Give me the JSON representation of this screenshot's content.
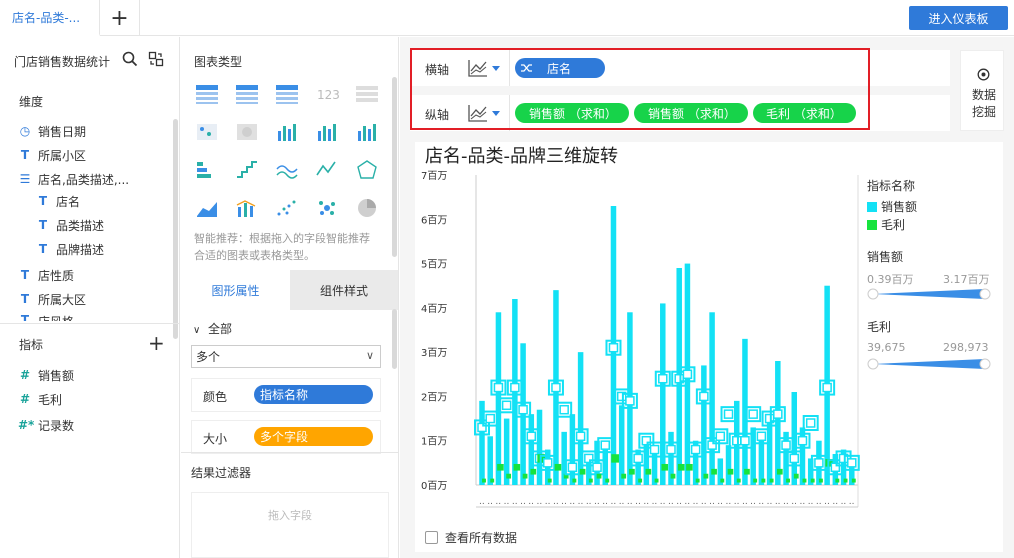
{
  "topbar": {
    "tab_label": "店名-品类-...",
    "add_label": "+",
    "enter_button": "进入仪表板"
  },
  "left": {
    "title": "门店销售数据统计",
    "dimension_label": "维度",
    "dimensions": [
      {
        "icon": "clock-icon",
        "label": "销售日期"
      },
      {
        "icon": "text-field-icon",
        "label": "所属小区"
      },
      {
        "icon": "tree-icon",
        "label": "店名,品类描述,..."
      },
      {
        "icon": "text-field-icon",
        "label": "店名",
        "sub": true
      },
      {
        "icon": "text-field-icon",
        "label": "品类描述",
        "sub": true
      },
      {
        "icon": "text-field-icon",
        "label": "品牌描述",
        "sub": true
      },
      {
        "icon": "text-field-icon",
        "label": "店性质"
      },
      {
        "icon": "text-field-icon",
        "label": "所属大区"
      },
      {
        "icon": "text-field-icon",
        "label": "店风格"
      }
    ],
    "measure_label": "指标",
    "measures": [
      {
        "icon": "hash-icon",
        "label": "销售额"
      },
      {
        "icon": "hash-icon",
        "label": "毛利"
      },
      {
        "icon": "hash-star-icon",
        "label": "记录数"
      }
    ]
  },
  "middle": {
    "chart_type_title": "图表类型",
    "smart_note": "智能推荐：根据拖入的字段智能推荐合适的图表或表格类型。",
    "tab_graphic": "图形属性",
    "tab_style": "组件样式",
    "all_label": "全部",
    "select_value": "多个",
    "color_label": "颜色",
    "color_pill": "指标名称",
    "size_label": "大小",
    "size_pill": "多个字段",
    "filter_title": "结果过滤器",
    "filter_placeholder": "拖入字段"
  },
  "axes": {
    "x_label": "横轴",
    "x_fields": [
      "店名"
    ],
    "y_label": "纵轴",
    "y_fields": [
      "销售额 （求和）",
      "销售额 （求和）",
      "毛利 （求和）"
    ]
  },
  "mining": {
    "label": "数据挖掘"
  },
  "colors": {
    "primary": "#2f7ad9",
    "sales": "#13e1f5",
    "profit": "#17e33d",
    "red": "#e21e26",
    "size_pill": "#ffa500"
  },
  "chart_data": {
    "type": "bar",
    "title": "店名-品类-品牌三维旋转",
    "xlabel": "",
    "ylabel": "",
    "ylim": [
      0,
      7000000
    ],
    "y_ticks": [
      "0百万",
      "1百万",
      "2百万",
      "3百万",
      "4百万",
      "5百万",
      "6百万",
      "7百万"
    ],
    "series": [
      {
        "name": "销售额",
        "values": [
          1.9,
          1.1,
          3.9,
          1.5,
          4.2,
          3.2,
          1.6,
          1.7,
          0.8,
          4.4,
          1.2,
          1.6,
          3.0,
          0.5,
          1.0,
          0.9,
          6.3,
          1.8,
          3.9,
          0.8,
          1.1,
          0.7,
          4.1,
          1.2,
          4.9,
          5.0,
          1.0,
          2.7,
          3.9,
          0.6,
          0.9,
          1.9,
          3.3,
          1.3,
          1.0,
          1.6,
          2.8,
          1.2,
          2.1,
          1.3,
          0.6,
          1.0,
          4.5,
          0.7,
          0.8,
          0.6
        ],
        "markers": [
          1.3,
          1.5,
          2.2,
          1.8,
          2.2,
          1.7,
          1.1,
          0.6,
          0.5,
          2.2,
          1.7,
          0.4,
          1.1,
          0.6,
          0.4,
          0.9,
          3.1,
          2.0,
          1.9,
          0.6,
          1.0,
          0.8,
          2.4,
          0.8,
          2.4,
          2.5,
          0.8,
          2.0,
          0.9,
          1.1,
          1.6,
          1.0,
          1.0,
          1.6,
          1.1,
          1.5,
          1.6,
          0.9,
          0.6,
          1.0,
          1.4,
          0.5,
          2.2,
          0.4,
          0.6,
          0.5
        ]
      },
      {
        "name": "毛利",
        "values": [
          0.1,
          0.1,
          0.4,
          0.2,
          0.4,
          0.2,
          0.3,
          0.6,
          0.1,
          0.4,
          0.2,
          0.1,
          0.3,
          0.1,
          0.2,
          0.1,
          0.6,
          0.2,
          0.3,
          0.1,
          0.3,
          0.1,
          0.4,
          0.2,
          0.4,
          0.4,
          0.1,
          0.2,
          0.3,
          0.1,
          0.3,
          0.1,
          0.3,
          0.1,
          0.1,
          0.1,
          0.3,
          0.1,
          0.2,
          0.1,
          0.1,
          0.1,
          0.5,
          0.1,
          0.1,
          0.1
        ]
      }
    ],
    "legend": {
      "title": "指标名称",
      "items": [
        "销售额",
        "毛利"
      ],
      "position": "right"
    },
    "size_legends": [
      {
        "title": "销售额",
        "min": "0.39百万",
        "max": "3.17百万"
      },
      {
        "title": "毛利",
        "min": "39,675",
        "max": "298,973"
      }
    ],
    "view_all": "查看所有数据"
  }
}
